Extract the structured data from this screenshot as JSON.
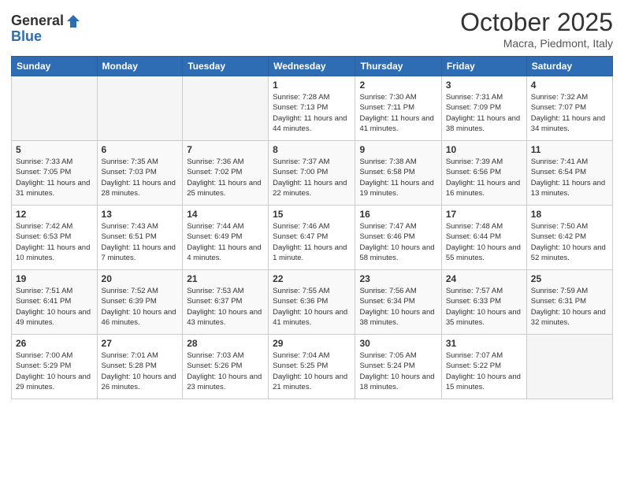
{
  "logo": {
    "general": "General",
    "blue": "Blue"
  },
  "header": {
    "month": "October 2025",
    "location": "Macra, Piedmont, Italy"
  },
  "weekdays": [
    "Sunday",
    "Monday",
    "Tuesday",
    "Wednesday",
    "Thursday",
    "Friday",
    "Saturday"
  ],
  "weeks": [
    [
      {
        "day": "",
        "info": ""
      },
      {
        "day": "",
        "info": ""
      },
      {
        "day": "",
        "info": ""
      },
      {
        "day": "1",
        "info": "Sunrise: 7:28 AM\nSunset: 7:13 PM\nDaylight: 11 hours and 44 minutes."
      },
      {
        "day": "2",
        "info": "Sunrise: 7:30 AM\nSunset: 7:11 PM\nDaylight: 11 hours and 41 minutes."
      },
      {
        "day": "3",
        "info": "Sunrise: 7:31 AM\nSunset: 7:09 PM\nDaylight: 11 hours and 38 minutes."
      },
      {
        "day": "4",
        "info": "Sunrise: 7:32 AM\nSunset: 7:07 PM\nDaylight: 11 hours and 34 minutes."
      }
    ],
    [
      {
        "day": "5",
        "info": "Sunrise: 7:33 AM\nSunset: 7:05 PM\nDaylight: 11 hours and 31 minutes."
      },
      {
        "day": "6",
        "info": "Sunrise: 7:35 AM\nSunset: 7:03 PM\nDaylight: 11 hours and 28 minutes."
      },
      {
        "day": "7",
        "info": "Sunrise: 7:36 AM\nSunset: 7:02 PM\nDaylight: 11 hours and 25 minutes."
      },
      {
        "day": "8",
        "info": "Sunrise: 7:37 AM\nSunset: 7:00 PM\nDaylight: 11 hours and 22 minutes."
      },
      {
        "day": "9",
        "info": "Sunrise: 7:38 AM\nSunset: 6:58 PM\nDaylight: 11 hours and 19 minutes."
      },
      {
        "day": "10",
        "info": "Sunrise: 7:39 AM\nSunset: 6:56 PM\nDaylight: 11 hours and 16 minutes."
      },
      {
        "day": "11",
        "info": "Sunrise: 7:41 AM\nSunset: 6:54 PM\nDaylight: 11 hours and 13 minutes."
      }
    ],
    [
      {
        "day": "12",
        "info": "Sunrise: 7:42 AM\nSunset: 6:53 PM\nDaylight: 11 hours and 10 minutes."
      },
      {
        "day": "13",
        "info": "Sunrise: 7:43 AM\nSunset: 6:51 PM\nDaylight: 11 hours and 7 minutes."
      },
      {
        "day": "14",
        "info": "Sunrise: 7:44 AM\nSunset: 6:49 PM\nDaylight: 11 hours and 4 minutes."
      },
      {
        "day": "15",
        "info": "Sunrise: 7:46 AM\nSunset: 6:47 PM\nDaylight: 11 hours and 1 minute."
      },
      {
        "day": "16",
        "info": "Sunrise: 7:47 AM\nSunset: 6:46 PM\nDaylight: 10 hours and 58 minutes."
      },
      {
        "day": "17",
        "info": "Sunrise: 7:48 AM\nSunset: 6:44 PM\nDaylight: 10 hours and 55 minutes."
      },
      {
        "day": "18",
        "info": "Sunrise: 7:50 AM\nSunset: 6:42 PM\nDaylight: 10 hours and 52 minutes."
      }
    ],
    [
      {
        "day": "19",
        "info": "Sunrise: 7:51 AM\nSunset: 6:41 PM\nDaylight: 10 hours and 49 minutes."
      },
      {
        "day": "20",
        "info": "Sunrise: 7:52 AM\nSunset: 6:39 PM\nDaylight: 10 hours and 46 minutes."
      },
      {
        "day": "21",
        "info": "Sunrise: 7:53 AM\nSunset: 6:37 PM\nDaylight: 10 hours and 43 minutes."
      },
      {
        "day": "22",
        "info": "Sunrise: 7:55 AM\nSunset: 6:36 PM\nDaylight: 10 hours and 41 minutes."
      },
      {
        "day": "23",
        "info": "Sunrise: 7:56 AM\nSunset: 6:34 PM\nDaylight: 10 hours and 38 minutes."
      },
      {
        "day": "24",
        "info": "Sunrise: 7:57 AM\nSunset: 6:33 PM\nDaylight: 10 hours and 35 minutes."
      },
      {
        "day": "25",
        "info": "Sunrise: 7:59 AM\nSunset: 6:31 PM\nDaylight: 10 hours and 32 minutes."
      }
    ],
    [
      {
        "day": "26",
        "info": "Sunrise: 7:00 AM\nSunset: 5:29 PM\nDaylight: 10 hours and 29 minutes."
      },
      {
        "day": "27",
        "info": "Sunrise: 7:01 AM\nSunset: 5:28 PM\nDaylight: 10 hours and 26 minutes."
      },
      {
        "day": "28",
        "info": "Sunrise: 7:03 AM\nSunset: 5:26 PM\nDaylight: 10 hours and 23 minutes."
      },
      {
        "day": "29",
        "info": "Sunrise: 7:04 AM\nSunset: 5:25 PM\nDaylight: 10 hours and 21 minutes."
      },
      {
        "day": "30",
        "info": "Sunrise: 7:05 AM\nSunset: 5:24 PM\nDaylight: 10 hours and 18 minutes."
      },
      {
        "day": "31",
        "info": "Sunrise: 7:07 AM\nSunset: 5:22 PM\nDaylight: 10 hours and 15 minutes."
      },
      {
        "day": "",
        "info": ""
      }
    ]
  ]
}
